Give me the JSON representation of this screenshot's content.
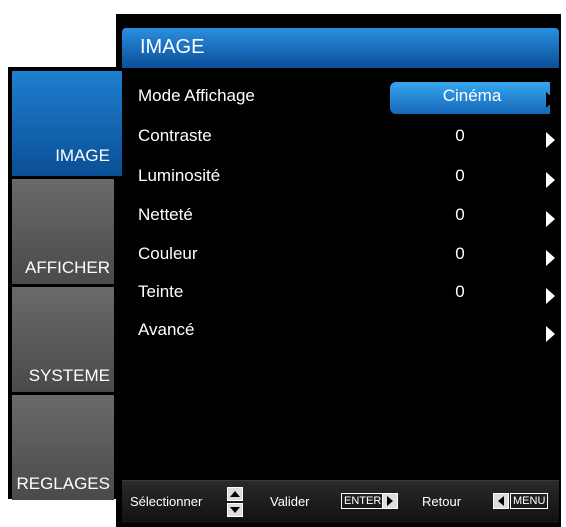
{
  "tabs": [
    {
      "label": "IMAGE",
      "active": true
    },
    {
      "label": "AFFICHER",
      "active": false
    },
    {
      "label": "SYSTEME",
      "active": false
    },
    {
      "label": "REGLAGES",
      "active": false
    }
  ],
  "window": {
    "title": "IMAGE"
  },
  "settings": [
    {
      "label": "Mode Affichage",
      "value": "Cinéma",
      "selected": true
    },
    {
      "label": "Contraste",
      "value": "0"
    },
    {
      "label": "Luminosité",
      "value": "0"
    },
    {
      "label": "Netteté",
      "value": "0"
    },
    {
      "label": "Couleur",
      "value": "0"
    },
    {
      "label": "Teinte",
      "value": "0"
    },
    {
      "label": "Avancé",
      "value": ""
    }
  ],
  "footer": {
    "select_label": "Sélectionner",
    "validate_label": "Valider",
    "enter_key": "ENTER",
    "back_label": "Retour",
    "menu_key": "MENU"
  },
  "colors": {
    "accent": "#1467b8",
    "highlight": "#38a6ef",
    "background": "#000000",
    "tab_inactive": "#555555"
  },
  "icons": [
    "arrow-right-icon",
    "up-down-icon",
    "enter-arrow-icon",
    "back-arrow-icon"
  ]
}
